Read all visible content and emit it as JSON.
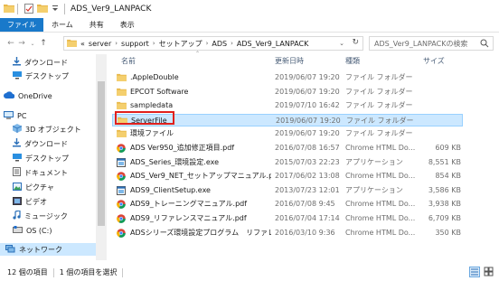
{
  "window": {
    "title": "ADS_Ver9_LANPACK"
  },
  "ribbon": {
    "tabs": [
      "ファイル",
      "ホーム",
      "共有",
      "表示"
    ]
  },
  "address": {
    "crumbs": [
      "«",
      "server",
      "support",
      "セットアップ",
      "ADS",
      "ADS_Ver9_LANPACK"
    ]
  },
  "search": {
    "placeholder": "ADS_Ver9_LANPACKの検索"
  },
  "nav": {
    "items": [
      {
        "label": "ダウンロード",
        "icon": "download-arrow-icon"
      },
      {
        "label": "デスクトップ",
        "icon": "desktop-icon"
      },
      {
        "label": "OneDrive",
        "icon": "cloud-icon"
      },
      {
        "label": "PC",
        "icon": "pc-icon"
      },
      {
        "label": "3D オブジェクト",
        "icon": "cube-icon"
      },
      {
        "label": "ダウンロード",
        "icon": "download-arrow-icon"
      },
      {
        "label": "デスクトップ",
        "icon": "desktop-icon"
      },
      {
        "label": "ドキュメント",
        "icon": "document-icon"
      },
      {
        "label": "ピクチャ",
        "icon": "picture-icon"
      },
      {
        "label": "ビデオ",
        "icon": "video-icon"
      },
      {
        "label": "ミュージック",
        "icon": "music-icon"
      },
      {
        "label": "OS (C:)",
        "icon": "drive-icon"
      },
      {
        "label": "ネットワーク",
        "icon": "network-icon"
      }
    ]
  },
  "columns": {
    "name": "名前",
    "date": "更新日時",
    "type": "種類",
    "size": "サイズ"
  },
  "files": [
    {
      "name": ".AppleDouble",
      "date": "2019/06/07 19:20",
      "type": "ファイル フォルダー",
      "size": "",
      "icon": "folder-icon"
    },
    {
      "name": "EPCOT Software",
      "date": "2019/06/07 19:20",
      "type": "ファイル フォルダー",
      "size": "",
      "icon": "folder-icon"
    },
    {
      "name": "sampledata",
      "date": "2019/07/10 16:42",
      "type": "ファイル フォルダー",
      "size": "",
      "icon": "folder-icon"
    },
    {
      "name": "ServerFile",
      "date": "2019/06/07 19:20",
      "type": "ファイル フォルダー",
      "size": "",
      "icon": "folder-icon"
    },
    {
      "name": "環境ファイル",
      "date": "2019/06/07 19:20",
      "type": "ファイル フォルダー",
      "size": "",
      "icon": "folder-icon"
    },
    {
      "name": "ADS Ver950_追加修正項目.pdf",
      "date": "2016/07/08 16:57",
      "type": "Chrome HTML Do...",
      "size": "609 KB",
      "icon": "chrome-icon"
    },
    {
      "name": "ADS_Series_環境設定.exe",
      "date": "2015/07/03 22:23",
      "type": "アプリケーション",
      "size": "8,551 KB",
      "icon": "app-icon"
    },
    {
      "name": "ADS_Ver9_NET_セットアップマニュアル.pdf",
      "date": "2017/06/02 13:08",
      "type": "Chrome HTML Do...",
      "size": "854 KB",
      "icon": "chrome-icon"
    },
    {
      "name": "ADS9_ClientSetup.exe",
      "date": "2013/07/23 12:01",
      "type": "アプリケーション",
      "size": "3,586 KB",
      "icon": "app-icon"
    },
    {
      "name": "ADS9_トレーニングマニュアル.pdf",
      "date": "2016/07/08 9:45",
      "type": "Chrome HTML Do...",
      "size": "3,938 KB",
      "icon": "chrome-icon"
    },
    {
      "name": "ADS9_リファレンスマニュアル.pdf",
      "date": "2016/07/04 17:14",
      "type": "Chrome HTML Do...",
      "size": "6,709 KB",
      "icon": "chrome-icon"
    },
    {
      "name": "ADSシリーズ環境設定プログラム　リファレンス...",
      "date": "2016/03/10 9:36",
      "type": "Chrome HTML Do...",
      "size": "350 KB",
      "icon": "chrome-icon"
    }
  ],
  "selected_index": 3,
  "status": {
    "count": "12 個の項目",
    "selected": "1 個の項目を選択"
  },
  "colors": {
    "accent": "#1979ca",
    "selection": "#cce8ff",
    "highlight": "#e0201c",
    "folder": "#e8b84a"
  }
}
